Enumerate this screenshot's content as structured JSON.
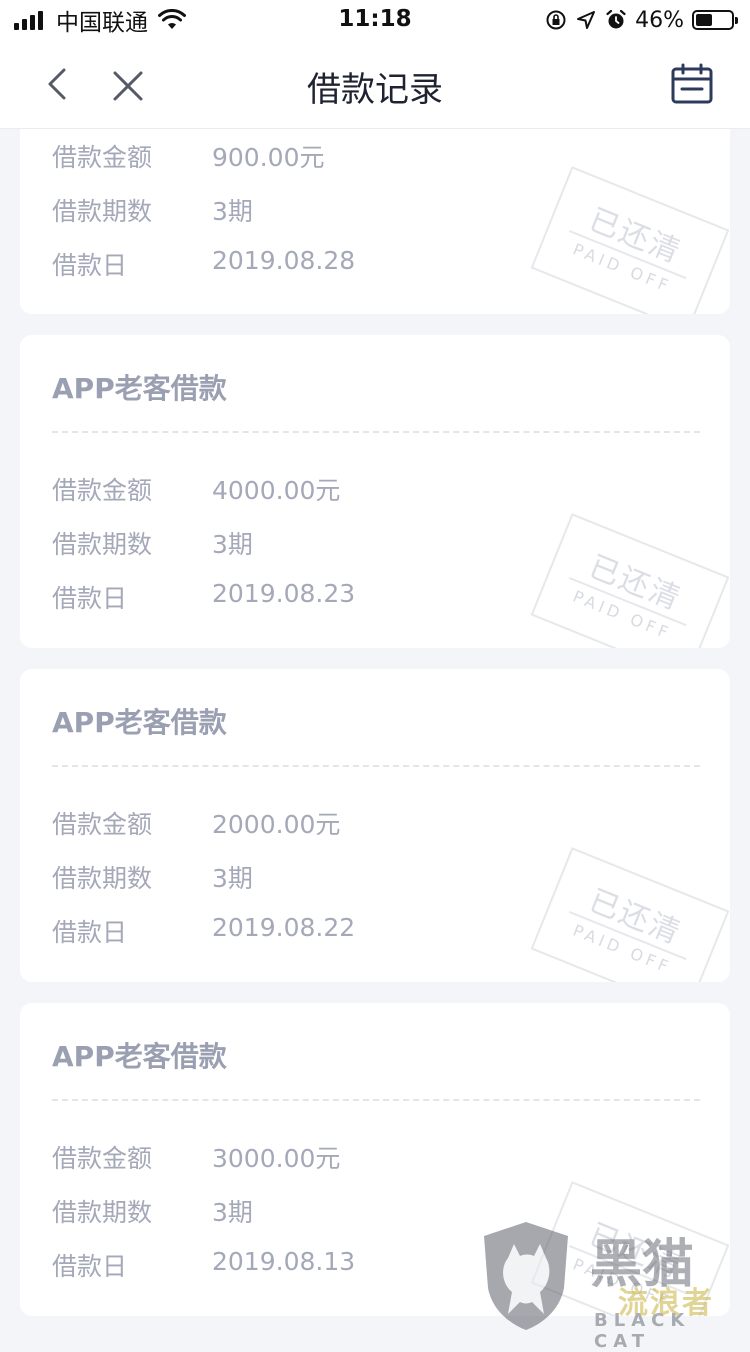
{
  "status_bar": {
    "carrier": "中国联通",
    "time": "11:18",
    "battery": "46%",
    "battery_level": 0.46,
    "icons": [
      "signal-icon",
      "wifi-icon",
      "orientation-lock-icon",
      "location-icon",
      "alarm-icon",
      "battery-icon"
    ]
  },
  "nav": {
    "title": "借款记录",
    "back_icon": "chevron-left-icon",
    "close_icon": "close-icon",
    "calendar_icon": "calendar-icon"
  },
  "labels": {
    "amount": "借款金额",
    "periods": "借款期数",
    "date": "借款日"
  },
  "stamp": {
    "cn": "已还清",
    "en": "PAID OFF"
  },
  "loans": [
    {
      "title": "",
      "amount": "900.00元",
      "periods": "3期",
      "date": "2019.08.28"
    },
    {
      "title": "APP老客借款",
      "amount": "4000.00元",
      "periods": "3期",
      "date": "2019.08.23"
    },
    {
      "title": "APP老客借款",
      "amount": "2000.00元",
      "periods": "3期",
      "date": "2019.08.22"
    },
    {
      "title": "APP老客借款",
      "amount": "3000.00元",
      "periods": "3期",
      "date": "2019.08.13"
    }
  ],
  "watermark": {
    "cn_top": "黑猫",
    "cn_bottom": "流浪者",
    "en": "BLACK CAT"
  }
}
